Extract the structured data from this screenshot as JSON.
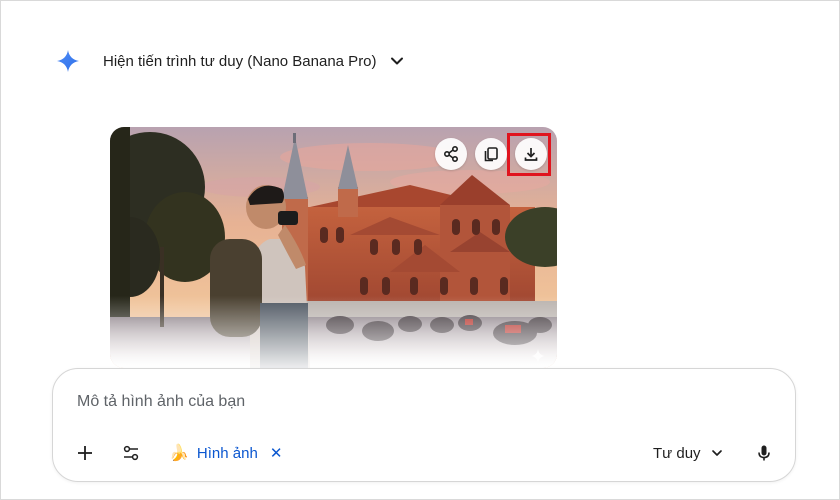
{
  "header": {
    "thinking_label": "Hiện tiến trình tư duy (Nano Banana Pro)",
    "gem_icon": "gemini-sparkle-icon"
  },
  "image_card": {
    "actions": [
      {
        "name": "share",
        "icon": "share-icon"
      },
      {
        "name": "copy",
        "icon": "copy-icon"
      },
      {
        "name": "download",
        "icon": "download-icon",
        "highlighted": true
      }
    ]
  },
  "composer": {
    "placeholder": "Mô tả hình ảnh của bạn",
    "add_icon": "plus-icon",
    "tools_icon": "tune-icon",
    "chip": {
      "emoji": "🍌",
      "label": "Hình ảnh",
      "close": "✕"
    },
    "mode": {
      "label": "Tư duy"
    },
    "mic_icon": "microphone-icon"
  },
  "colors": {
    "accent_blue": "#0b57d0",
    "highlight_red": "#e0141e",
    "gem_blue": "#3b7bf5"
  }
}
